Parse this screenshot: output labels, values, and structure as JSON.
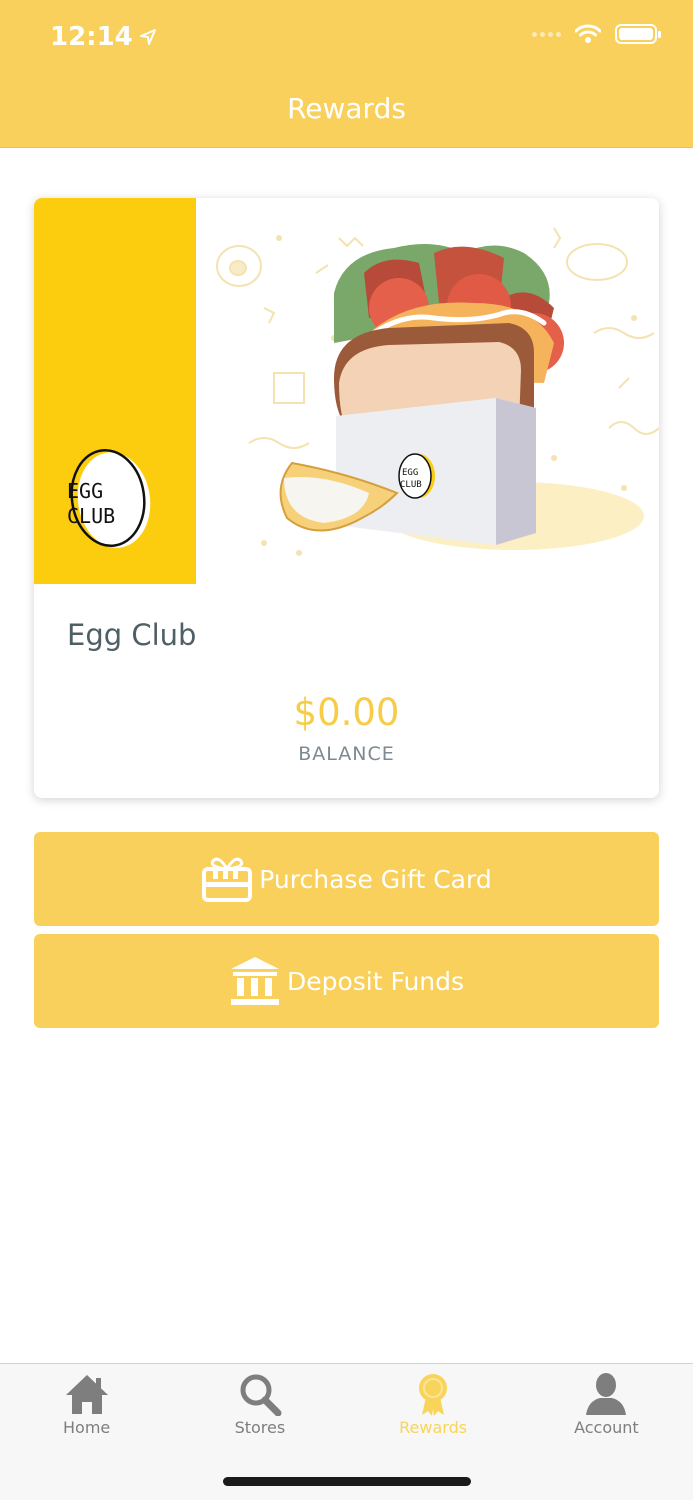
{
  "status_bar": {
    "time": "12:14"
  },
  "header": {
    "title": "Rewards"
  },
  "card": {
    "brand_logo_line1": "EGG",
    "brand_logo_line2": "CLUB",
    "merchant_name": "Egg Club",
    "balance_amount": "$0.00",
    "balance_label": "BALANCE"
  },
  "actions": {
    "purchase_label": "Purchase Gift Card",
    "deposit_label": "Deposit Funds"
  },
  "tabs": [
    {
      "label": "Home",
      "icon": "home-icon",
      "active": false
    },
    {
      "label": "Stores",
      "icon": "search-icon",
      "active": false
    },
    {
      "label": "Rewards",
      "icon": "award-icon",
      "active": true
    },
    {
      "label": "Account",
      "icon": "user-icon",
      "active": false
    }
  ],
  "colors": {
    "header": "#fad05c",
    "brand_yellow": "#fbcd0e",
    "accent": "#f6cd45",
    "tab_active": "#f8d45a",
    "tab_inactive": "#7e7e7e"
  }
}
